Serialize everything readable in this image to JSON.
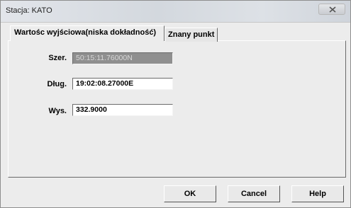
{
  "window": {
    "title": "Stacja: KATO"
  },
  "tabs": [
    {
      "label": "Wartośc wyjściowa(niska dokładność)",
      "active": true
    },
    {
      "label": "Znany punkt",
      "active": false
    }
  ],
  "fields": {
    "lat": {
      "label": "Szer.",
      "value": "50:15:11.76000N",
      "enabled": false
    },
    "lon": {
      "label": "Dług.",
      "value": "19:02:08.27000E",
      "enabled": true
    },
    "alt": {
      "label": "Wys.",
      "value": "332.9000",
      "enabled": true
    }
  },
  "buttons": {
    "ok": "OK",
    "cancel": "Cancel",
    "help": "Help"
  }
}
